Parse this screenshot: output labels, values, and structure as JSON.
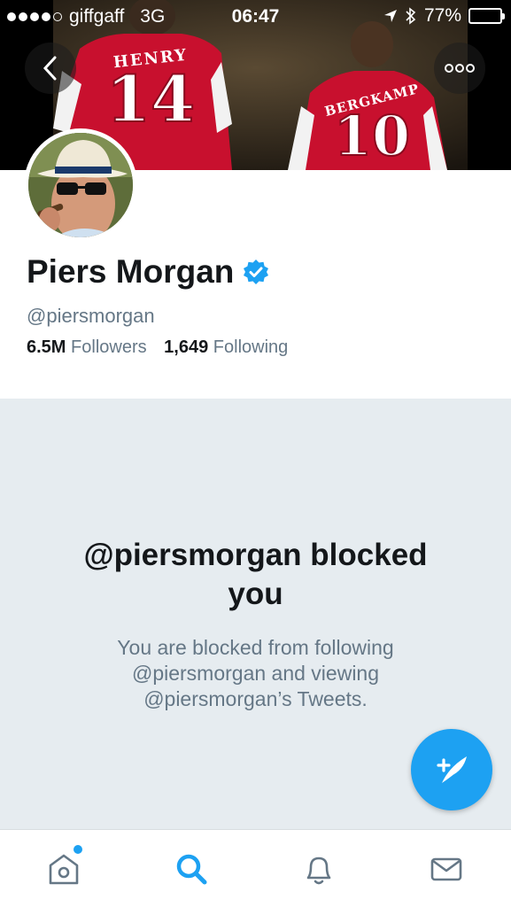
{
  "status_bar": {
    "carrier": "giffgaff",
    "network": "3G",
    "time": "06:47",
    "battery_percent": "77%",
    "battery_level": 0.77,
    "signal_dots_filled": 4,
    "signal_dots_total": 5
  },
  "banner": {
    "left_jersey": {
      "name": "HENRY",
      "number": "14"
    },
    "right_jersey": {
      "name": "BERGKAMP",
      "number": "10"
    }
  },
  "profile": {
    "name": "Piers Morgan",
    "verified": true,
    "handle": "@piersmorgan",
    "followers_count": "6.5M",
    "followers_label": "Followers",
    "following_count": "1,649",
    "following_label": "Following"
  },
  "blocked": {
    "heading_line1": "@piersmorgan blocked",
    "heading_line2": "you",
    "message_line1": "You are blocked from following",
    "message_line2": "@piersmorgan and viewing",
    "message_line3": "@piersmorgan’s Tweets."
  },
  "tabbar": {
    "items": [
      "home-icon",
      "search-icon",
      "notifications-icon",
      "messages-icon"
    ],
    "active": "search-icon",
    "home_has_notification": true
  },
  "colors": {
    "accent": "#1da1f2",
    "verified": "#1da1f2",
    "blocked_bg": "#e6ecf0",
    "secondary_text": "#657786",
    "jersey_red": "#c8102e"
  }
}
